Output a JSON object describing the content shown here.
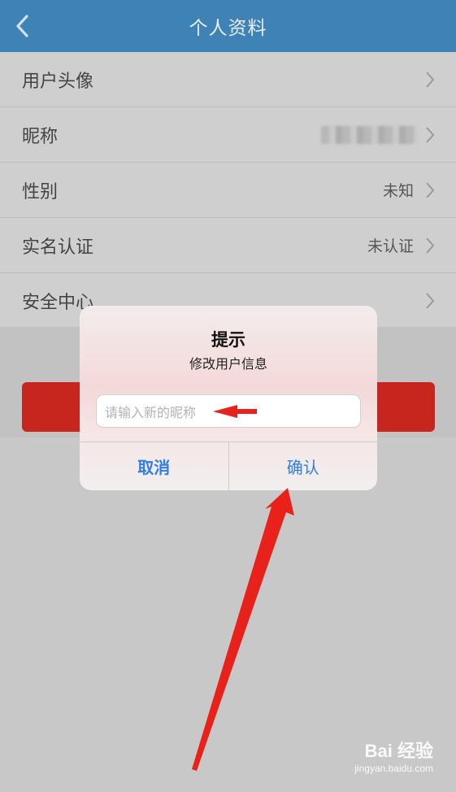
{
  "header": {
    "title": "个人资料",
    "back_icon": "chevron-left-icon"
  },
  "list": {
    "items": [
      {
        "label": "用户头像",
        "value": ""
      },
      {
        "label": "昵称",
        "value": ""
      },
      {
        "label": "性别",
        "value": "未知"
      },
      {
        "label": "实名认证",
        "value": "未认证"
      },
      {
        "label": "安全中心",
        "value": ""
      }
    ]
  },
  "dialog": {
    "title": "提示",
    "message": "修改用户信息",
    "input_placeholder": "请输入新的昵称",
    "cancel_label": "取消",
    "confirm_label": "确认"
  },
  "watermark": {
    "brand": "Bai 经验",
    "url": "jingyan.baidu.com"
  },
  "colors": {
    "header_bg": "#3f82b5",
    "accent_blue": "#2f7ee3",
    "button_red": "#c6261e",
    "arrow_red": "#e8221b"
  }
}
